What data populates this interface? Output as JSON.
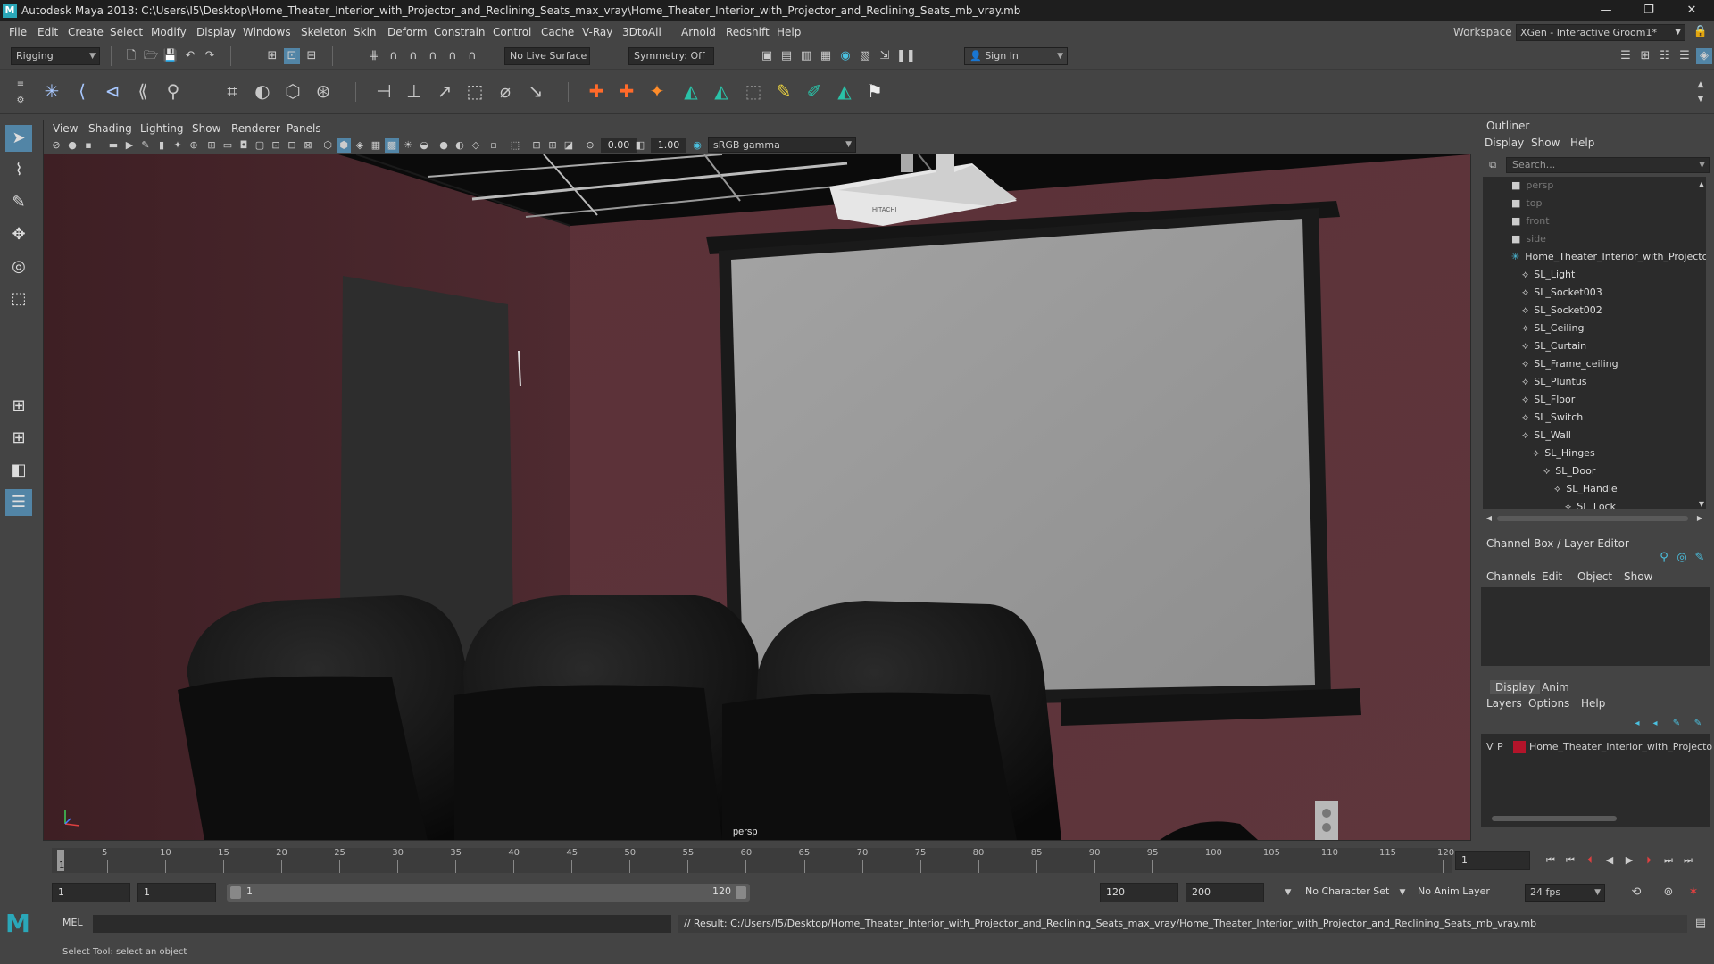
{
  "window": {
    "title": "Autodesk Maya 2018: C:\\Users\\I5\\Desktop\\Home_Theater_Interior_with_Projector_and_Reclining_Seats_max_vray\\Home_Theater_Interior_with_Projector_and_Reclining_Seats_mb_vray.mb",
    "app_icon": "M",
    "minimize": "—",
    "maximize": "❐",
    "close": "✕"
  },
  "menubar": {
    "items": [
      "File",
      "Edit",
      "Create",
      "Select",
      "Modify",
      "Display",
      "Windows",
      "Skeleton",
      "Skin",
      "Deform",
      "Constrain",
      "Control",
      "Cache",
      "V-Ray",
      "3DtoAll",
      "Arnold",
      "Redshift",
      "Help"
    ],
    "workspace_label": "Workspace :",
    "workspace_value": "XGen - Interactive Groom1*"
  },
  "status_line": {
    "mode": "Rigging",
    "live_surface": "No Live Surface",
    "symmetry": "Symmetry: Off",
    "sign_in": "Sign In"
  },
  "viewport": {
    "menus": [
      "View",
      "Shading",
      "Lighting",
      "Show",
      "Renderer",
      "Panels"
    ],
    "exposure": "0.00",
    "gamma": "1.00",
    "color_space": "sRGB gamma",
    "camera_label": "persp",
    "projector_brand": "HITACHI"
  },
  "outliner": {
    "title": "Outliner",
    "menus": [
      "Display",
      "Show",
      "Help"
    ],
    "search_placeholder": "Search...",
    "items": [
      {
        "label": "persp",
        "level": 1,
        "dim": true
      },
      {
        "label": "top",
        "level": 1,
        "dim": true
      },
      {
        "label": "front",
        "level": 1,
        "dim": true
      },
      {
        "label": "side",
        "level": 1,
        "dim": true
      },
      {
        "label": "Home_Theater_Interior_with_Projecto",
        "level": 1,
        "dim": false
      },
      {
        "label": "SL_Light",
        "level": 2,
        "dim": false
      },
      {
        "label": "SL_Socket003",
        "level": 2,
        "dim": false
      },
      {
        "label": "SL_Socket002",
        "level": 2,
        "dim": false
      },
      {
        "label": "SL_Ceiling",
        "level": 2,
        "dim": false
      },
      {
        "label": "SL_Curtain",
        "level": 2,
        "dim": false
      },
      {
        "label": "SL_Frame_ceiling",
        "level": 2,
        "dim": false
      },
      {
        "label": "SL_Pluntus",
        "level": 2,
        "dim": false
      },
      {
        "label": "SL_Floor",
        "level": 2,
        "dim": false
      },
      {
        "label": "SL_Switch",
        "level": 2,
        "dim": false
      },
      {
        "label": "SL_Wall",
        "level": 2,
        "dim": false
      },
      {
        "label": "SL_Hinges",
        "level": 3,
        "dim": false
      },
      {
        "label": "SL_Door",
        "level": 4,
        "dim": false
      },
      {
        "label": "SL_Handle",
        "level": 5,
        "dim": false
      },
      {
        "label": "SL_Lock",
        "level": 6,
        "dim": false
      }
    ]
  },
  "channel_box": {
    "title": "Channel Box / Layer Editor",
    "menus": [
      "Channels",
      "Edit",
      "Object",
      "Show"
    ],
    "tabs": [
      "Display",
      "Anim"
    ],
    "layer_menus": [
      "Layers",
      "Options",
      "Help"
    ],
    "layer": {
      "v": "V",
      "p": "P",
      "name": "Home_Theater_Interior_with_Projecto",
      "color": "#b3142a"
    }
  },
  "timeline": {
    "ticks": [
      "5",
      "10",
      "15",
      "20",
      "25",
      "30",
      "35",
      "40",
      "45",
      "50",
      "55",
      "60",
      "65",
      "70",
      "75",
      "80",
      "85",
      "90",
      "95",
      "100",
      "105",
      "110",
      "115",
      "120"
    ],
    "current_frame_marker": "1",
    "current_frame_field": "1"
  },
  "range": {
    "start": "1",
    "anim_start": "1",
    "slider_start": "1",
    "slider_end": "120",
    "end": "120",
    "anim_end": "200",
    "character_set": "No Character Set",
    "anim_layer": "No Anim Layer",
    "fps": "24 fps"
  },
  "command_line": {
    "label": "MEL",
    "result": "// Result: C:/Users/I5/Desktop/Home_Theater_Interior_with_Projector_and_Reclining_Seats_max_vray/Home_Theater_Interior_with_Projector_and_Reclining_Seats_mb_vray.mb"
  },
  "help_line": {
    "text": "Select Tool: select an object"
  },
  "colors": {
    "wall": "#5a2f36",
    "screen": "#9a9a9a",
    "seat": "#121212",
    "accent": "#2aa7b8"
  }
}
